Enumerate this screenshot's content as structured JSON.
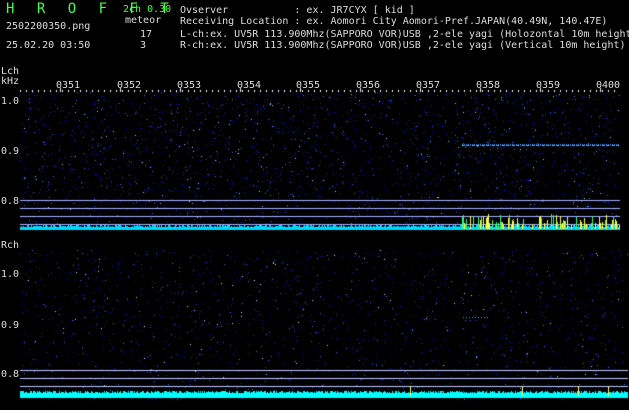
{
  "header": {
    "title": "H R O F F T",
    "version": "2ch 0.30",
    "filename": "2502200350.png",
    "meteor_label": "meteor",
    "timestamp": "25.02.20 03:50",
    "lch_count": "17",
    "rch_count": "3"
  },
  "info": {
    "observer": "Ovserver           : ex. JR7CYX [ kid ]",
    "location": "Receiving Location : ex. Aomori City Aomori-Pref.JAPAN(40.49N, 140.47E)",
    "lch": "L-ch:ex. UV5R 113.900Mhz(SAPPORO VOR)USB ,2-ele yagi (Holozontal 10m height",
    "rch": "R-ch:ex. UV5R 113.900Mhz(SAPPORO VOR)USB ,2-ele yagi (Vertical 10m height)"
  },
  "lch_panel": {
    "label": "Lch",
    "unit": "kHz",
    "time_ticks": [
      "0351",
      "0352",
      "0353",
      "0354",
      "0355",
      "0356",
      "0357",
      "0358",
      "0359",
      "0400"
    ],
    "freq_ticks": [
      "1.0",
      "0.9",
      "0.8"
    ]
  },
  "rch_panel": {
    "label": "Rch",
    "freq_ticks": [
      "1.0",
      "0.9",
      "0.8"
    ]
  },
  "colors": {
    "title": "#44ff44",
    "text": "#dddddd",
    "noise_bg": "#000060",
    "signal": "#00e0ff",
    "meteor": "#ffff00"
  }
}
